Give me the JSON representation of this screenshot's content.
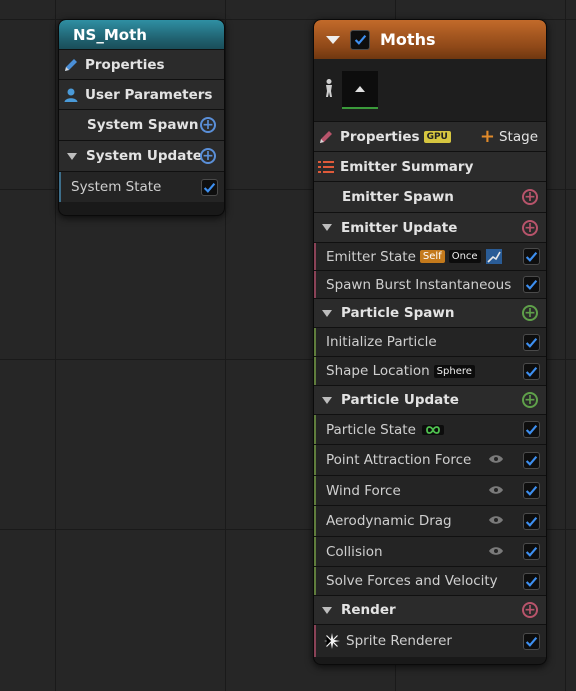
{
  "system_node": {
    "title": "NS_Moth",
    "properties_label": "Properties",
    "user_parameters_label": "User Parameters",
    "system_spawn_label": "System Spawn",
    "system_update_label": "System Update",
    "system_state_label": "System State"
  },
  "emitter_node": {
    "title": "Moths",
    "properties_label": "Properties",
    "gpu_badge": "GPU",
    "stage_label": "Stage",
    "emitter_summary_label": "Emitter Summary",
    "emitter_spawn_label": "Emitter Spawn",
    "emitter_update_label": "Emitter Update",
    "emitter_state_label": "Emitter State",
    "self_tag": "Self",
    "once_tag": "Once",
    "spawn_burst_label": "Spawn Burst Instantaneous",
    "particle_spawn_label": "Particle Spawn",
    "initialize_particle_label": "Initialize Particle",
    "shape_location_label": "Shape Location",
    "sphere_tag": "Sphere",
    "particle_update_label": "Particle Update",
    "particle_state_label": "Particle State",
    "point_attraction_label": "Point Attraction Force",
    "wind_force_label": "Wind Force",
    "aerodynamic_drag_label": "Aerodynamic Drag",
    "collision_label": "Collision",
    "solve_forces_label": "Solve Forces and Velocity",
    "render_label": "Render",
    "sprite_renderer_label": "Sprite Renderer"
  },
  "colors": {
    "system_header": "#1f5e6c",
    "emitter_header": "#8e4818",
    "check_blue": "#3d8ff0",
    "spawn_green": "#5fa04a",
    "render_pink": "#b8546b"
  }
}
